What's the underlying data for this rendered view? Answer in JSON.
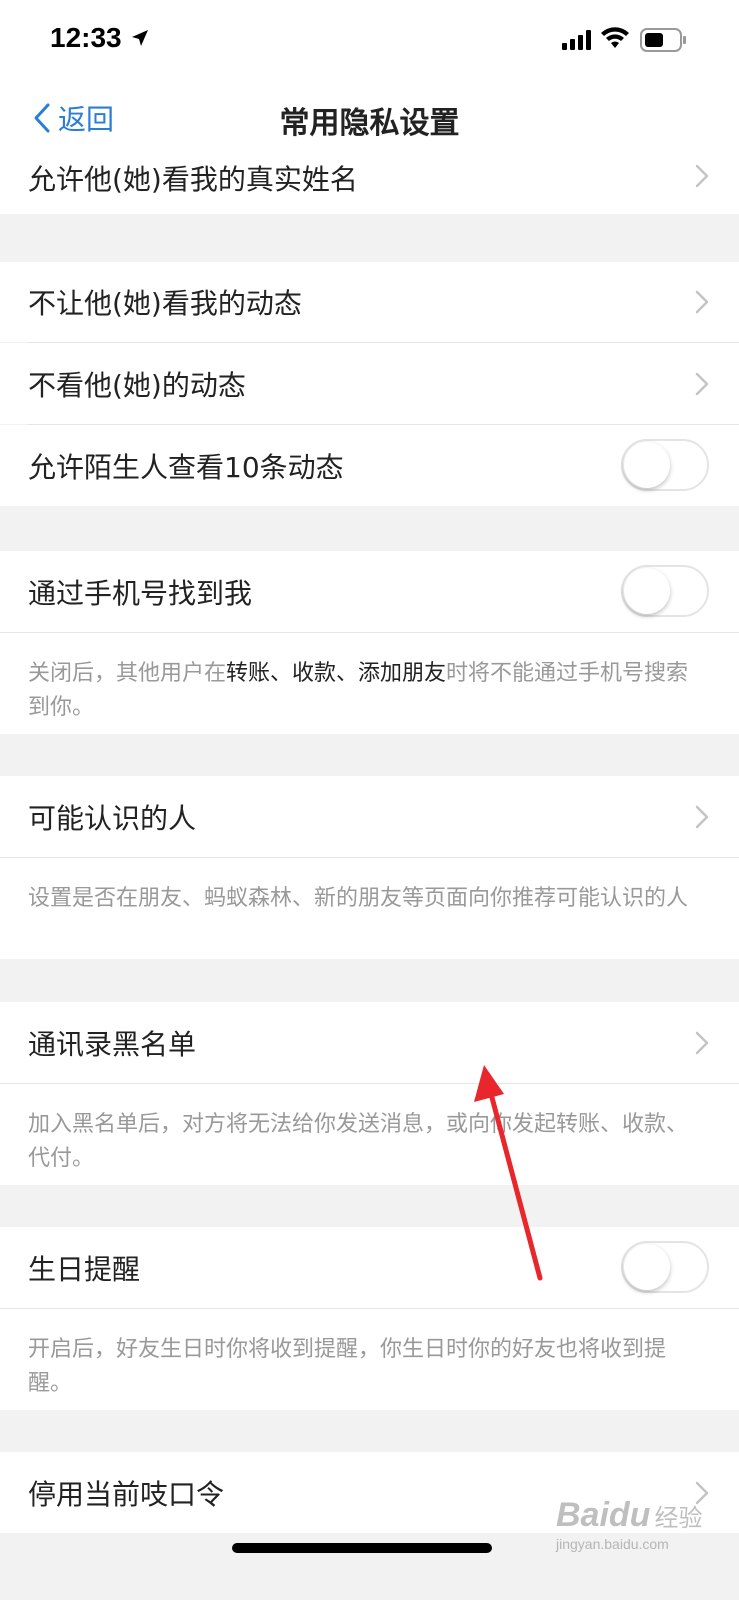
{
  "status_bar": {
    "time": "12:33",
    "icons": [
      "location-arrow-icon",
      "signal-icon",
      "wifi-icon",
      "battery-icon"
    ]
  },
  "nav": {
    "back_label": "返回",
    "title": "常用隐私设置"
  },
  "rows": {
    "real_name": "允许他(她)看我的真实姓名",
    "hide_my_feed": "不让他(她)看我的动态",
    "not_see_feed": "不看他(她)的动态",
    "stranger_feed": "允许陌生人查看10条动态",
    "find_by_phone": "通过手机号找到我",
    "people_may_know": "可能认识的人",
    "contacts_blacklist": "通讯录黑名单",
    "birthday_reminder": "生日提醒",
    "disable_password": "停用当前吱口令"
  },
  "toggles": {
    "stranger_feed": false,
    "find_by_phone": false,
    "birthday_reminder": false
  },
  "notes": {
    "phone_pre": "关闭后，其他用户在",
    "phone_hl": "转账、收款、添加朋友",
    "phone_post": "时将不能通过手机号搜索到你。",
    "people": "设置是否在朋友、蚂蚁森林、新的朋友等页面向你推荐可能认识的人",
    "blacklist": "加入黑名单后，对方将无法给你发送消息，或向你发起转账、收款、代付。",
    "birthday": "开启后，好友生日时你将收到提醒，你生日时你的好友也将收到提醒。"
  },
  "watermark": {
    "brand": "Baidu",
    "sub": "经验",
    "url": "jingyan.baidu.com"
  },
  "colors": {
    "accent": "#2a7fd4",
    "background": "#f2f2f2",
    "arrow": "#e8262b"
  }
}
